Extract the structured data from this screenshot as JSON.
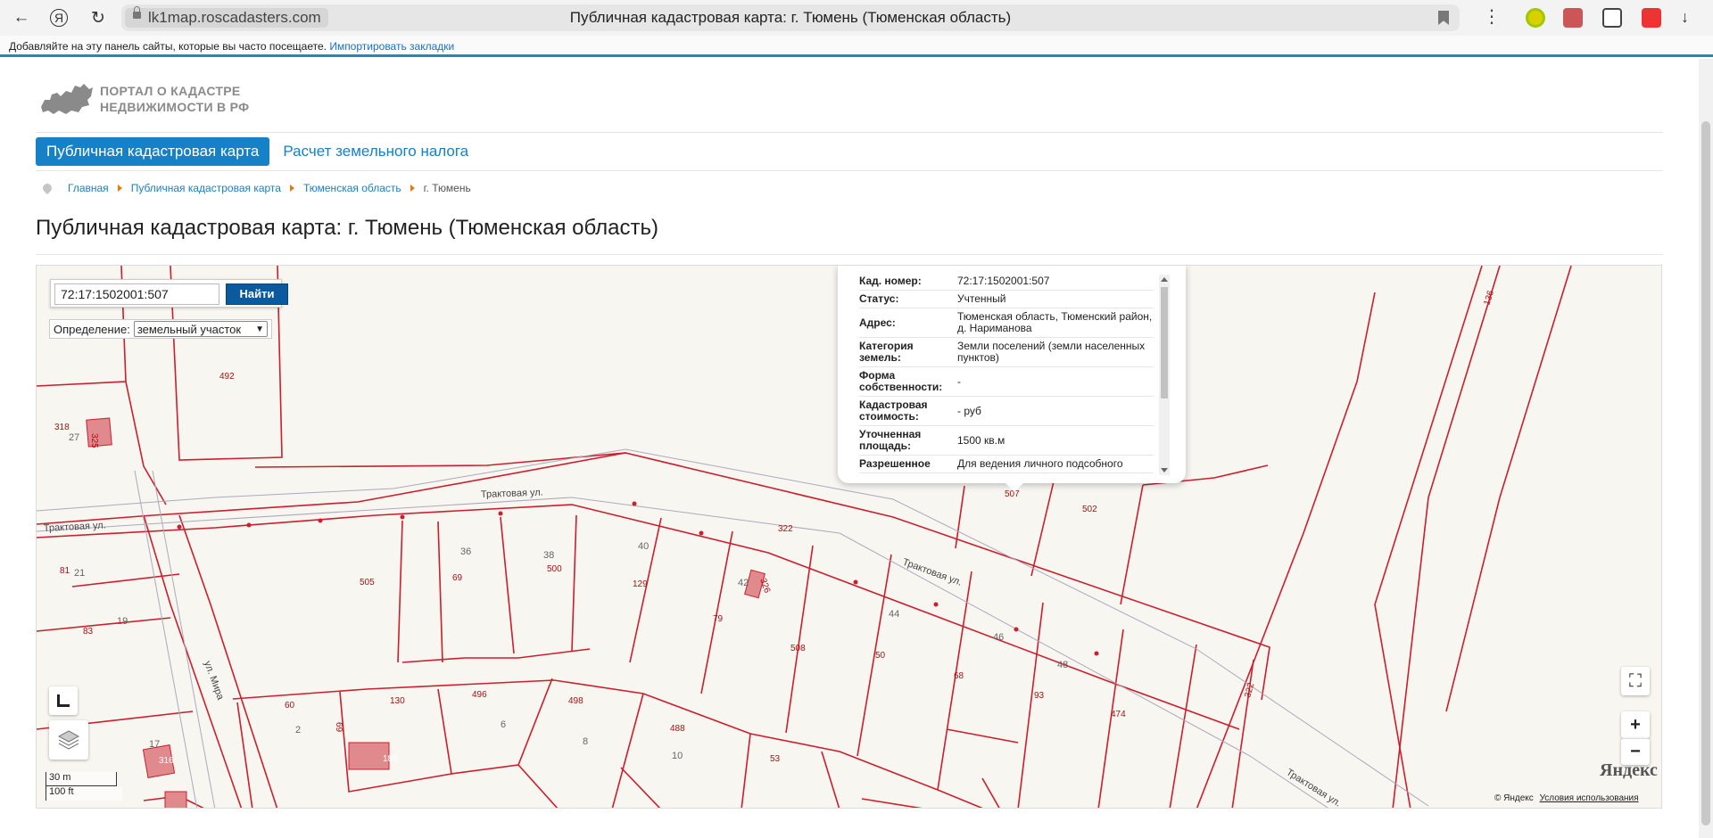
{
  "browser": {
    "domain": "lk1map.roscadasters.com",
    "tab_title": "Публичная кадастровая карта: г. Тюмень (Тюменская область)",
    "bookmarks_text": "Добавляйте на эту панель сайты, которые вы часто посещаете.",
    "bookmarks_link": "Импортировать закладки"
  },
  "header": {
    "logo_line1": "ПОРТАЛ О КАДАСТРЕ",
    "logo_line2": "НЕДВИЖИМОСТИ В РФ",
    "menu_active": "Публичная кадастровая карта",
    "menu_link": "Расчет земельного налога"
  },
  "breadcrumbs": [
    "Главная",
    "Публичная кадастровая карта",
    "Тюменская область",
    "г. Тюмень"
  ],
  "page_title": "Публичная кадастровая карта: г. Тюмень (Тюменская область)",
  "map": {
    "search_value": "72:17:1502001:507",
    "search_button": "Найти",
    "definition_label": "Определение:",
    "definition_value": "земельный участок",
    "scale_m": "30 m",
    "scale_ft": "100 ft",
    "yandex_logo": "Яндекс",
    "copyright": "© Яндекс",
    "terms": "Условия использования",
    "zoom_in": "+",
    "zoom_out": "−",
    "street_labels": [
      "Трактовая ул.",
      "Трактовая ул.",
      "Трактовая ул.",
      "Трактовая ул.",
      "ул. Мира"
    ],
    "parcel_labels": [
      "492",
      "318",
      "27",
      "325",
      "81",
      "21",
      "83",
      "19",
      "505",
      "36",
      "69",
      "38",
      "500",
      "40",
      "129",
      "42",
      "326",
      "79",
      "322",
      "507",
      "502",
      "508",
      "44",
      "50",
      "46",
      "68",
      "48",
      "93",
      "474",
      "322",
      "60",
      "2",
      "69",
      "130",
      "188",
      "496",
      "6",
      "498",
      "8",
      "488",
      "10",
      "53",
      "17",
      "316",
      "136"
    ],
    "popup": {
      "rows": [
        {
          "key": "Кад. номер:",
          "value": "72:17:1502001:507"
        },
        {
          "key": "Статус:",
          "value": "Учтенный"
        },
        {
          "key": "Адрес:",
          "value": "Тюменская область, Тюменский район, д. Нариманова"
        },
        {
          "key": "Категория земель:",
          "value": "Земли поселений (земли населенных пунктов)"
        },
        {
          "key": "Форма собственности:",
          "value": "-"
        },
        {
          "key": "Кадастровая стоимость:",
          "value": "- руб"
        },
        {
          "key": "Уточненная площадь:",
          "value": "1500 кв.м"
        },
        {
          "key": "Разрешенное",
          "value": "Для ведения личного подсобного"
        }
      ]
    }
  }
}
